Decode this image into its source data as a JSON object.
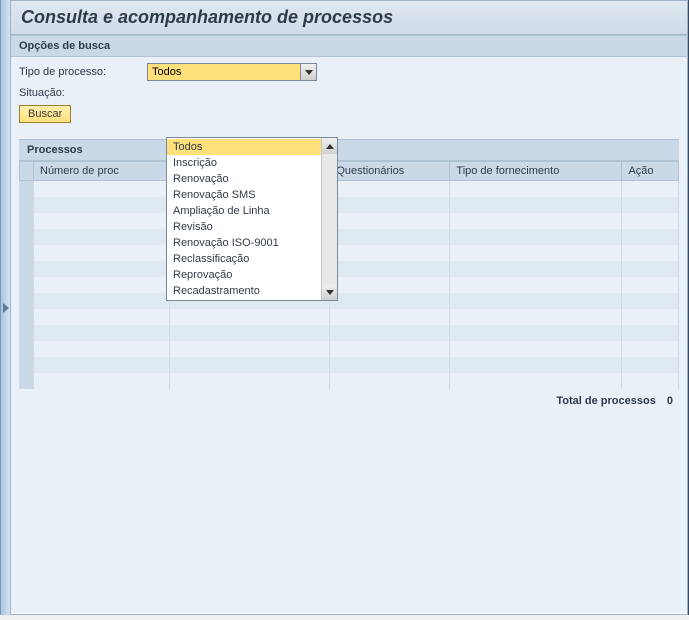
{
  "header": {
    "title": "Consulta e acompanhamento de processos"
  },
  "search": {
    "section_label": "Opções de busca",
    "type_label": "Tipo de processo:",
    "status_label": "Situação:",
    "button_label": "Buscar",
    "type_selected": "Todos",
    "dropdown_options": [
      "Todos",
      "Inscrição",
      "Renovação",
      "Renovação SMS",
      "Ampliação de Linha",
      "Revisão",
      "Renovação ISO-9001",
      "Reclassificação",
      "Reprovação",
      "Recadastramento"
    ]
  },
  "table": {
    "section_label": "Processos",
    "columns": {
      "num": "Número de proc",
      "questionarios": "Questionários",
      "tipo_fornecimento": "Tipo de fornecimento",
      "acao": "Ação"
    }
  },
  "footer": {
    "total_label": "Total de processos",
    "total_value": "0"
  }
}
